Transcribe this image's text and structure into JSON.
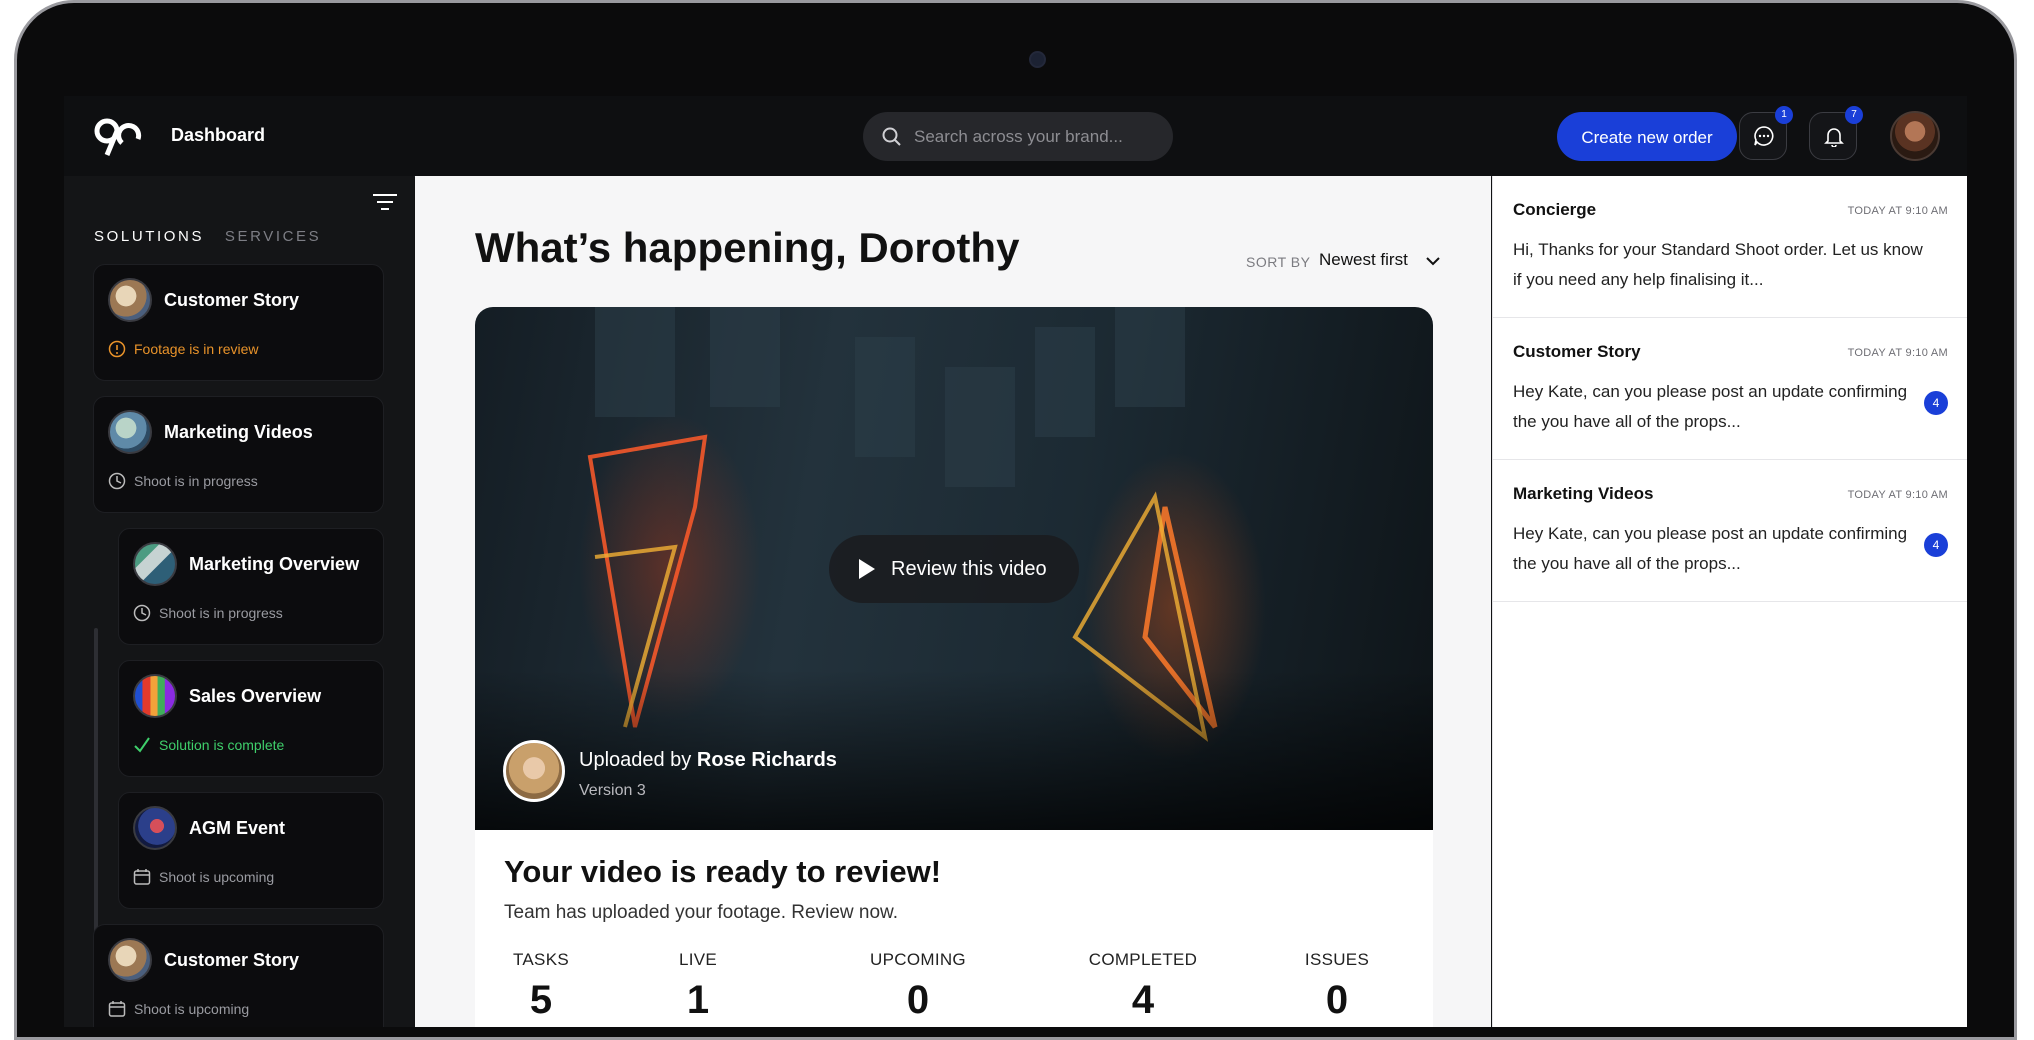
{
  "header": {
    "title": "Dashboard",
    "search_placeholder": "Search across your brand...",
    "create_button": "Create new order",
    "messages_badge": "1",
    "notifications_badge": "7"
  },
  "sidebar": {
    "tabs": [
      "SOLUTIONS",
      "SERVICES"
    ],
    "items": [
      {
        "title": "Customer Story",
        "status": "Footage is in review",
        "status_type": "warning"
      },
      {
        "title": "Marketing Videos",
        "status": "Shoot is in progress",
        "status_type": "progress"
      },
      {
        "title": "Marketing Overview",
        "status": "Shoot is in progress",
        "status_type": "progress"
      },
      {
        "title": "Sales Overview",
        "status": "Solution is complete",
        "status_type": "complete"
      },
      {
        "title": "AGM Event",
        "status": "Shoot is upcoming",
        "status_type": "upcoming"
      },
      {
        "title": "Customer Story",
        "status": "Shoot is upcoming",
        "status_type": "upcoming"
      }
    ]
  },
  "main": {
    "headline": "What’s happening, Dorothy",
    "sort_label": "SORT BY",
    "sort_value": "Newest first",
    "video": {
      "play_label": "Review this video",
      "uploaded_prefix": "Uploaded by",
      "uploader": "Rose Richards",
      "version": "Version 3"
    },
    "review": {
      "title": "Your video is ready to review!",
      "subtitle": "Team has uploaded your footage. Review now."
    },
    "stats": [
      {
        "label": "TASKS",
        "value": "5"
      },
      {
        "label": "LIVE",
        "value": "1"
      },
      {
        "label": "UPCOMING",
        "value": "0"
      },
      {
        "label": "COMPLETED",
        "value": "4"
      },
      {
        "label": "ISSUES",
        "value": "0"
      }
    ]
  },
  "messages": [
    {
      "title": "Concierge",
      "time": "TODAY AT 9:10 AM",
      "body": "Hi, Thanks for your Standard Shoot order. Let us know if you need any help finalising it...",
      "badge": ""
    },
    {
      "title": "Customer Story",
      "time": "TODAY AT 9:10 AM",
      "body": "Hey Kate, can you please post an update confirming the you have all of the props...",
      "badge": "4"
    },
    {
      "title": "Marketing Videos",
      "time": "TODAY AT 9:10 AM",
      "body": "Hey Kate, can you please post an update confirming the you have all of the props...",
      "badge": "4"
    }
  ],
  "colors": {
    "accent": "#1a3fd8",
    "warning": "#e9932a",
    "complete": "#3fcf6b",
    "sidebar_bg": "#141517",
    "card_bg": "#0c0c0e"
  }
}
